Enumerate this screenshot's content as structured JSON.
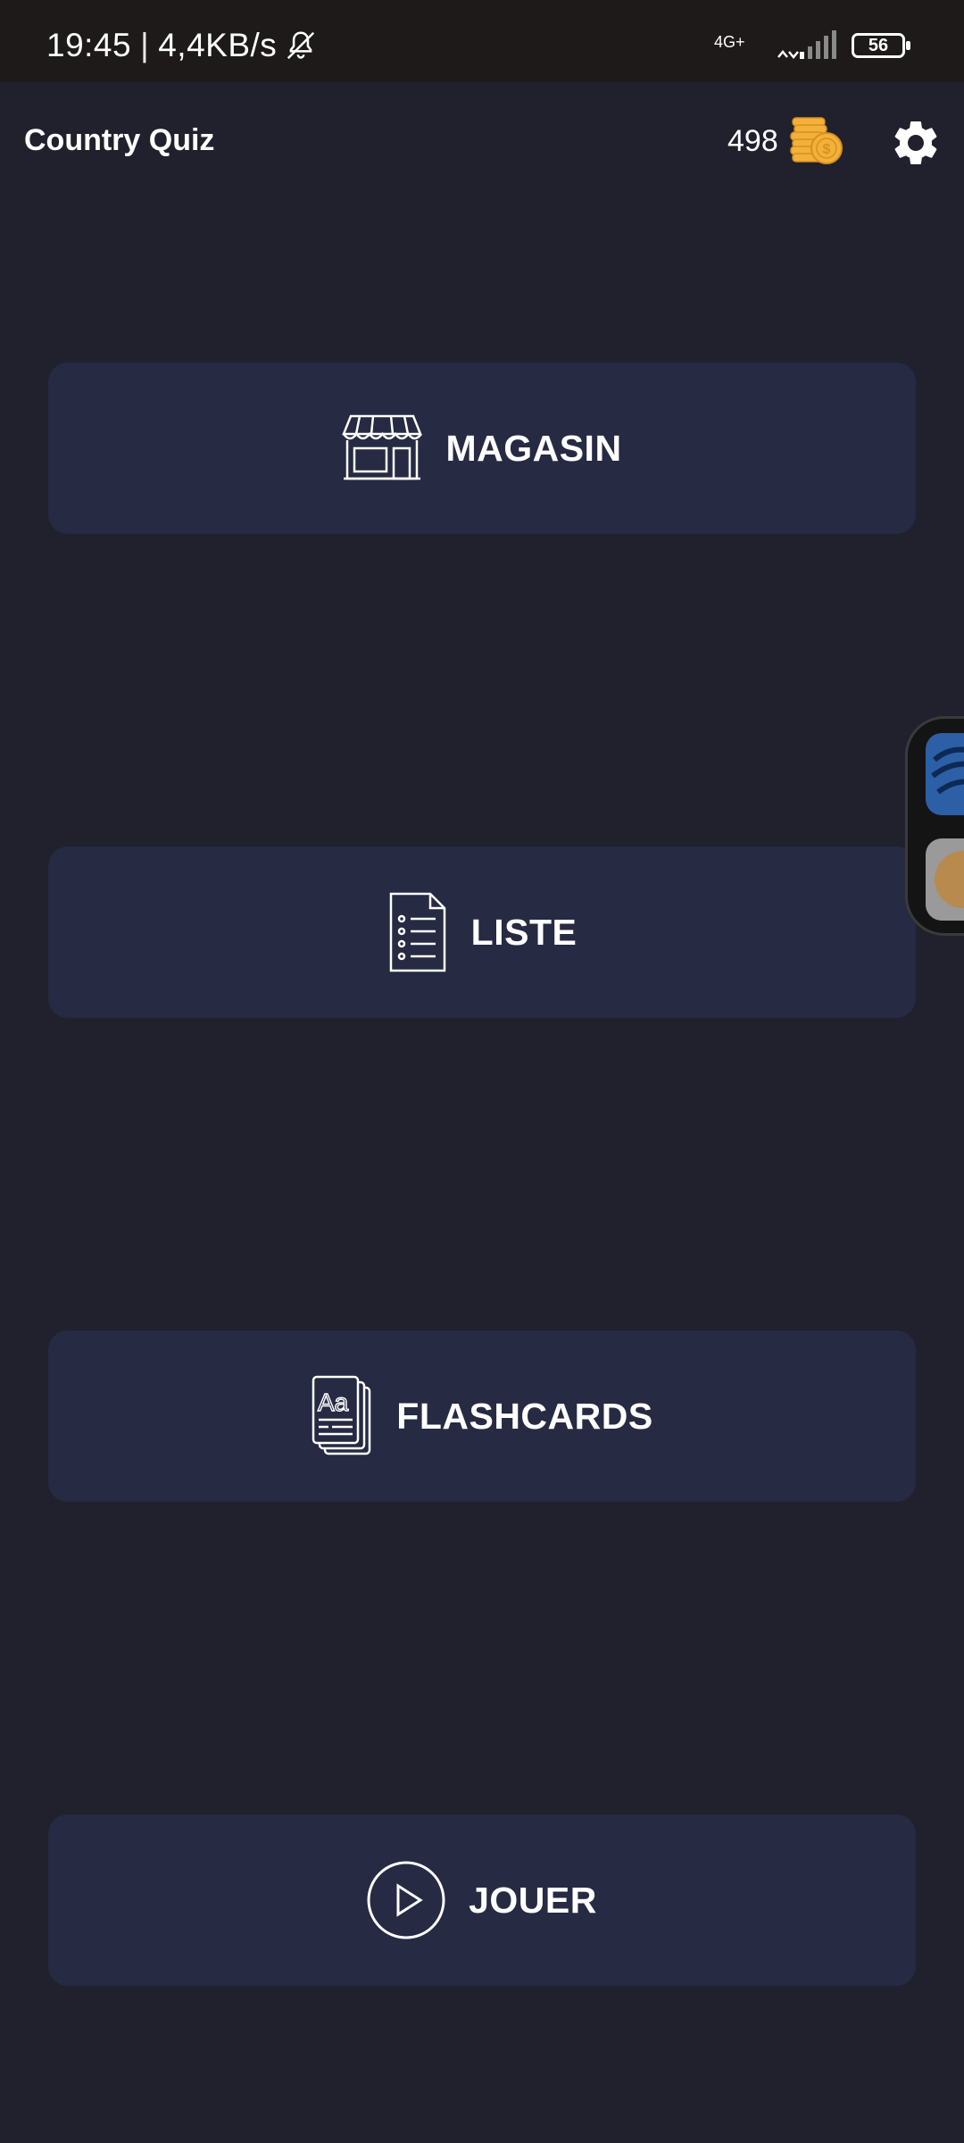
{
  "status_bar": {
    "time": "19:45",
    "separator": "|",
    "net_speed": "4,4KB/s",
    "network_type": "4G+",
    "battery": "56"
  },
  "app_bar": {
    "title": "Country Quiz",
    "coins": "498"
  },
  "menu": [
    {
      "label": "MAGASIN",
      "icon": "store-icon"
    },
    {
      "label": "LISTE",
      "icon": "list-document-icon"
    },
    {
      "label": "FLASHCARDS",
      "icon": "flashcards-icon"
    },
    {
      "label": "JOUER",
      "icon": "play-circle-icon"
    }
  ],
  "colors": {
    "background": "#20212d",
    "button": "#262a42",
    "status_bar": "#1d1a19",
    "coin": "#f2b13b"
  }
}
